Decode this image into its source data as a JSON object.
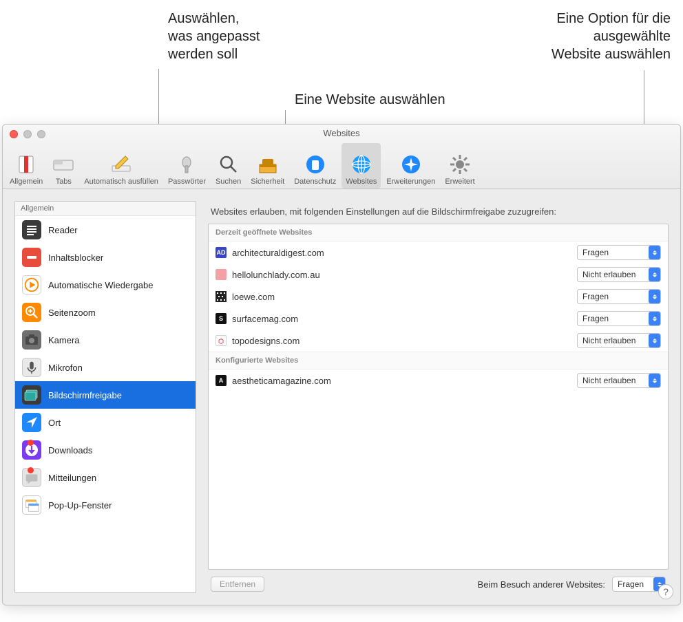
{
  "callouts": {
    "left": "Auswählen,\nwas angepasst\nwerden soll",
    "middle": "Eine Website auswählen",
    "right": "Eine Option für die\nausgewählte\nWebsite auswählen"
  },
  "window": {
    "title": "Websites"
  },
  "toolbar": {
    "items": [
      {
        "name": "general",
        "label": "Allgemein"
      },
      {
        "name": "tabs",
        "label": "Tabs"
      },
      {
        "name": "autofill",
        "label": "Automatisch ausfüllen"
      },
      {
        "name": "passwords",
        "label": "Passwörter"
      },
      {
        "name": "search",
        "label": "Suchen"
      },
      {
        "name": "security",
        "label": "Sicherheit"
      },
      {
        "name": "privacy",
        "label": "Datenschutz"
      },
      {
        "name": "websites",
        "label": "Websites"
      },
      {
        "name": "extensions",
        "label": "Erweiterungen"
      },
      {
        "name": "advanced",
        "label": "Erweitert"
      }
    ],
    "selected": "websites"
  },
  "sidebar": {
    "section": "Allgemein",
    "items": [
      {
        "name": "reader",
        "label": "Reader"
      },
      {
        "name": "contentblockers",
        "label": "Inhaltsblocker"
      },
      {
        "name": "autoplay",
        "label": "Automatische Wiedergabe"
      },
      {
        "name": "pagezoom",
        "label": "Seitenzoom"
      },
      {
        "name": "camera",
        "label": "Kamera"
      },
      {
        "name": "microphone",
        "label": "Mikrofon"
      },
      {
        "name": "screenshare",
        "label": "Bildschirmfreigabe"
      },
      {
        "name": "location",
        "label": "Ort"
      },
      {
        "name": "downloads",
        "label": "Downloads",
        "badge": true
      },
      {
        "name": "notifications",
        "label": "Mitteilungen",
        "badge": true
      },
      {
        "name": "popup",
        "label": "Pop-Up-Fenster"
      }
    ],
    "selected": "screenshare"
  },
  "main": {
    "description": "Websites erlauben, mit folgenden Einstellungen auf die Bildschirmfreigabe zuzugreifen:",
    "section_open": "Derzeit geöffnete Websites",
    "section_configured": "Konfigurierte Websites",
    "open_sites": [
      {
        "domain": "architecturaldigest.com",
        "value": "Fragen",
        "fav": "#3844c9",
        "txt": "AD",
        "col": "#fff"
      },
      {
        "domain": "hellolunchlady.com.au",
        "value": "Nicht erlauben",
        "fav": "#f3a1a7"
      },
      {
        "domain": "loewe.com",
        "value": "Fragen",
        "fav": "#222",
        "pattern": true
      },
      {
        "domain": "surfacemag.com",
        "value": "Fragen",
        "fav": "#111",
        "txt": "S",
        "col": "#fff"
      },
      {
        "domain": "topodesigns.com",
        "value": "Nicht erlauben",
        "fav": "#fff",
        "txt": "⬡",
        "col": "#e03b3b",
        "border": true
      }
    ],
    "configured_sites": [
      {
        "domain": "aestheticamagazine.com",
        "value": "Nicht erlauben",
        "fav": "#111",
        "txt": "A",
        "col": "#fff"
      }
    ],
    "remove_label": "Entfernen",
    "other_label": "Beim Besuch anderer Websites:",
    "other_value": "Fragen"
  },
  "help": "?"
}
